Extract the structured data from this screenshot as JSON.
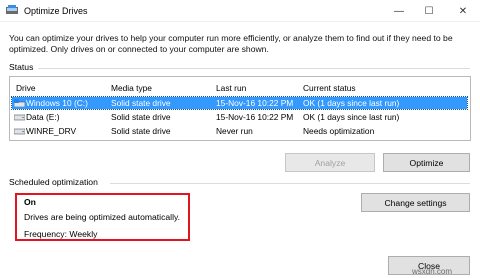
{
  "window": {
    "title": "Optimize Drives",
    "controls": {
      "minimize": "—",
      "maximize": "☐",
      "close": "✕"
    }
  },
  "intro_text": "You can optimize your drives to help your computer run more efficiently, or analyze them to find out if they need to be optimized. Only drives on or connected to your computer are shown.",
  "status": {
    "label": "Status",
    "columns": [
      "Drive",
      "Media type",
      "Last run",
      "Current status"
    ],
    "rows": [
      {
        "drive": "Windows 10 (C:)",
        "media_type": "Solid state drive",
        "last_run": "15-Nov-16 10:22 PM",
        "current_status": "OK (1 days since last run)",
        "selected": true,
        "icon": "system-drive-icon"
      },
      {
        "drive": "Data (E:)",
        "media_type": "Solid state drive",
        "last_run": "15-Nov-16 10:22 PM",
        "current_status": "OK (1 days since last run)",
        "selected": false,
        "icon": "drive-icon"
      },
      {
        "drive": "WINRE_DRV",
        "media_type": "Solid state drive",
        "last_run": "Never run",
        "current_status": "Needs optimization",
        "selected": false,
        "icon": "drive-icon"
      }
    ]
  },
  "buttons": {
    "analyze": "Analyze",
    "optimize": "Optimize",
    "change_settings": "Change settings",
    "close": "Close"
  },
  "scheduled": {
    "label": "Scheduled optimization",
    "state": "On",
    "description": "Drives are being optimized automatically.",
    "frequency": "Frequency: Weekly"
  },
  "watermark": "wsxdn.com",
  "colors": {
    "selection": "#3399ff",
    "highlight_border": "#e2151e"
  }
}
